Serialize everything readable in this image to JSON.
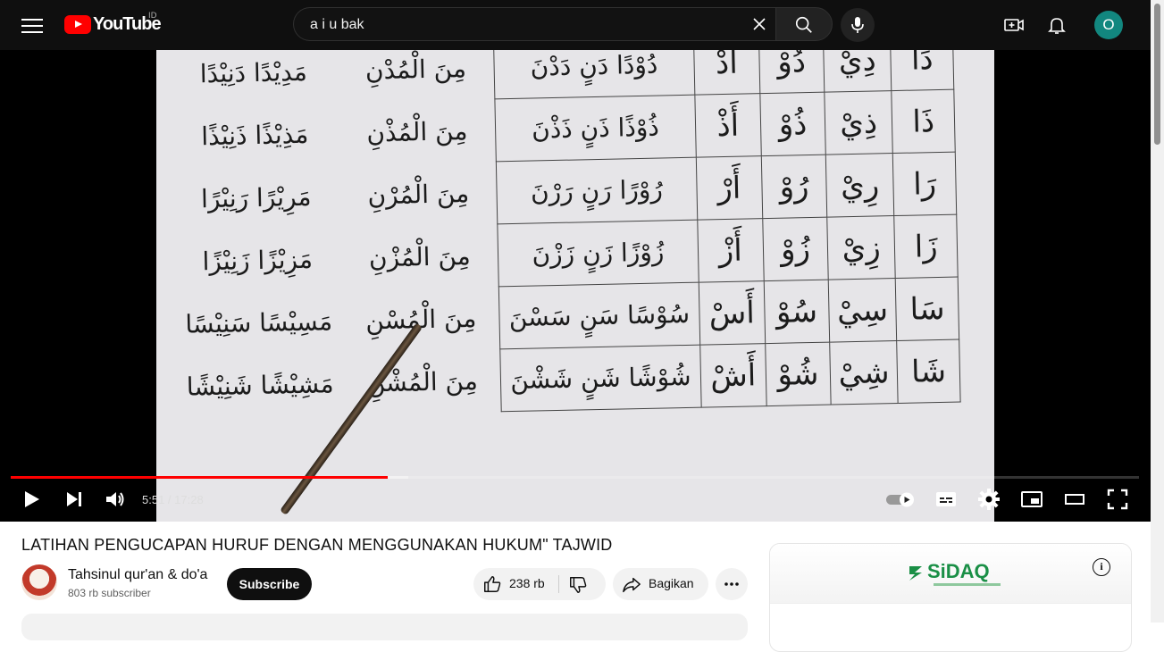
{
  "header": {
    "logo_text": "YouTube",
    "region": "ID",
    "search_value": "a i u bak",
    "avatar_initial": "O"
  },
  "video": {
    "table_rows": [
      [
        "دَا",
        "دِيْ",
        "دُوْ",
        "أَدْ",
        "دُوْدًا دَنٍ دَدْنَ",
        "مِنَ الْمُدْنِ",
        "مَدِيْدًا دَنِيْدًا"
      ],
      [
        "ذَا",
        "ذِيْ",
        "ذُوْ",
        "أَذْ",
        "ذُوْذًا ذَنٍ ذَذْنَ",
        "مِنَ الْمُذْنِ",
        "مَذِيْذًا ذَنِيْذًا"
      ],
      [
        "رَا",
        "رِيْ",
        "رُوْ",
        "أَرْ",
        "رُوْرًا رَنٍ رَرْنَ",
        "مِنَ الْمُرْنِ",
        "مَرِيْرًا رَنِيْرًا"
      ],
      [
        "زَا",
        "زِيْ",
        "زُوْ",
        "أَزْ",
        "زُوْزًا زَنٍ زَزْنَ",
        "مِنَ الْمُزْنِ",
        "مَزِيْزًا زَنِيْزًا"
      ],
      [
        "سَا",
        "سِيْ",
        "سُوْ",
        "أَسْ",
        "سُوْسًا سَنٍ سَسْنَ",
        "مِنَ الْمُسْنِ",
        "مَسِيْسًا سَنِيْسًا"
      ],
      [
        "شَا",
        "شِيْ",
        "شُوْ",
        "أَشْ",
        "شُوْشًا شَنٍ شَشْنَ",
        "مِنَ الْمُشْنِ",
        "مَشِيْشًا شَنِيْشًا"
      ]
    ],
    "time": "5:51 / 17:28",
    "progress_played": 0.334,
    "progress_buffered": 0.352
  },
  "details": {
    "title": "LATIHAN PENGUCAPAN HURUF DENGAN MENGGUNAKAN HUKUM\" TAJWID",
    "channel_name": "Tahsinul qur'an & do'a",
    "subscribers": "803 rb subscriber",
    "subscribe_label": "Subscribe",
    "likes": "238 rb",
    "share_label": "Bagikan"
  },
  "ad": {
    "brand": "SiDAQ"
  },
  "colors": {
    "accent": "#ff0000",
    "avatar_bg": "#12877f",
    "brand_green": "#1a8f46"
  },
  "icons": [
    "menu-icon",
    "youtube-logo-icon",
    "clear-icon",
    "search-icon",
    "mic-icon",
    "create-icon",
    "bell-icon",
    "play-icon",
    "next-icon",
    "volume-icon",
    "autoplay-toggle-icon",
    "subtitles-icon",
    "settings-icon",
    "miniplayer-icon",
    "theater-icon",
    "fullscreen-icon",
    "like-icon",
    "dislike-icon",
    "share-icon",
    "more-icon",
    "info-icon"
  ]
}
